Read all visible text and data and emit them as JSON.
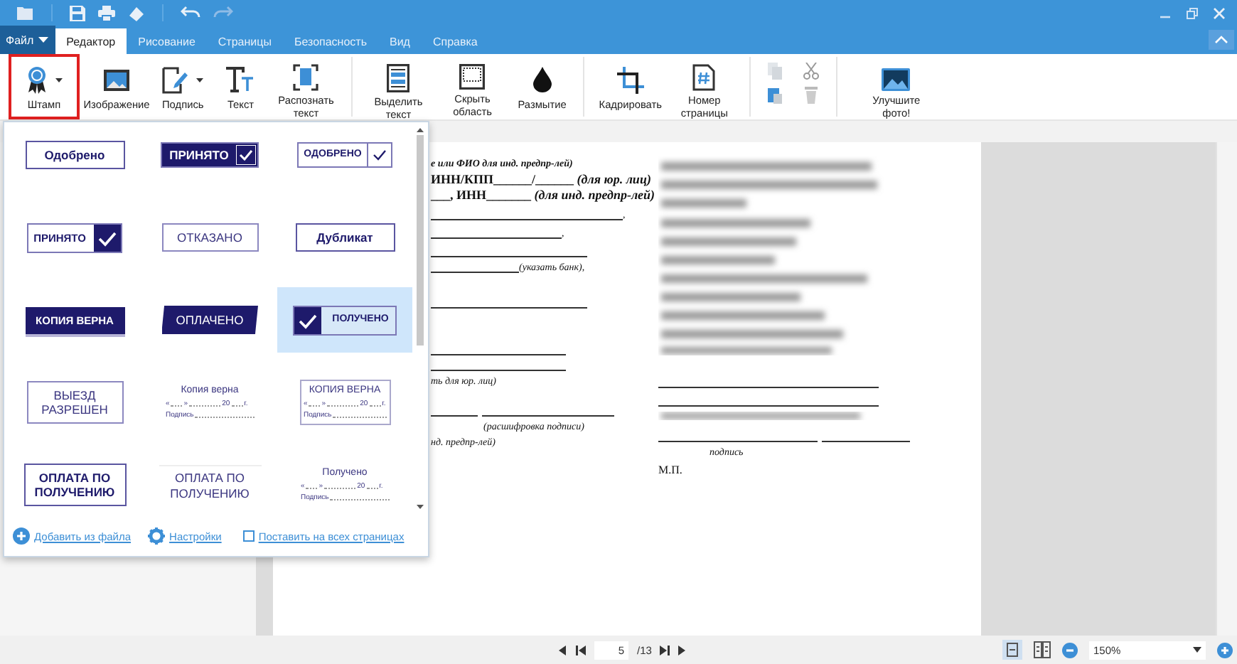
{
  "menu_tabs": [
    {
      "label": "Файл",
      "kind": "file",
      "selected": false
    },
    {
      "label": "Редактор",
      "kind": "tab",
      "selected": true
    },
    {
      "label": "Рисование",
      "kind": "tab",
      "selected": false
    },
    {
      "label": "Страницы",
      "kind": "tab",
      "selected": false
    },
    {
      "label": "Безопасность",
      "kind": "tab",
      "selected": false
    },
    {
      "label": "Вид",
      "kind": "tab",
      "selected": false
    },
    {
      "label": "Справка",
      "kind": "tab",
      "selected": false
    }
  ],
  "ribbon": [
    {
      "label": "Штамп",
      "dropdown": true,
      "highlighted": true
    },
    {
      "label": "Изображение",
      "dropdown": false,
      "highlighted": false
    },
    {
      "label": "Подпись",
      "dropdown": true,
      "highlighted": false
    },
    {
      "label": "Текст",
      "dropdown": false,
      "highlighted": false
    },
    {
      "label": "Распознать текст",
      "dropdown": false,
      "highlighted": false
    },
    {
      "label": "Выделить текст",
      "dropdown": false,
      "highlighted": false
    },
    {
      "label": "Скрыть область",
      "dropdown": false,
      "highlighted": false
    },
    {
      "label": "Размытие",
      "dropdown": false,
      "highlighted": false
    },
    {
      "label": "Кадрировать",
      "dropdown": false,
      "highlighted": false
    },
    {
      "label": "Номер страницы",
      "dropdown": false,
      "highlighted": false
    },
    {
      "label": "Улучшите фото!",
      "dropdown": false,
      "highlighted": false
    }
  ],
  "stamp_panel": {
    "stamps": [
      {
        "kind": "outline-bold",
        "text": "Одобрено",
        "selected": false
      },
      {
        "kind": "filled-check",
        "text": "ПРИНЯТО",
        "selected": false
      },
      {
        "kind": "outline-check",
        "text": "ОДОБРЕНО",
        "selected": false
      },
      {
        "kind": "check-box",
        "text": "ПРИНЯТО",
        "selected": false
      },
      {
        "kind": "outline-light",
        "text": "ОТКАЗАНО",
        "selected": false
      },
      {
        "kind": "outline-bold",
        "text": "Дубликат",
        "selected": false
      },
      {
        "kind": "filled",
        "text": "КОПИЯ ВЕРНА",
        "selected": false
      },
      {
        "kind": "slanted",
        "text": "ОПЛАЧЕНО",
        "selected": false
      },
      {
        "kind": "check-left",
        "text": "ПОЛУЧЕНО",
        "selected": true
      },
      {
        "kind": "outline-light",
        "text": "ВЫЕЗД РАЗРЕШЕН",
        "selected": false
      },
      {
        "kind": "form",
        "text": "Копия верна",
        "marks": [
          "«",
          "»",
          "20",
          "г."
        ],
        "sign": "Подпись",
        "selected": false
      },
      {
        "kind": "form-boxed",
        "text": "КОПИЯ ВЕРНА",
        "marks": [
          "«",
          "»",
          "20",
          "г."
        ],
        "sign": "Подпись",
        "selected": false
      },
      {
        "kind": "outline-bold",
        "text": "ОПЛАТА ПО ПОЛУЧЕНИЮ",
        "selected": false
      },
      {
        "kind": "plain",
        "text": "ОПЛАТА ПО ПОЛУЧЕНИЮ",
        "selected": false
      },
      {
        "kind": "form",
        "text": "Получено",
        "marks": [
          "«",
          "»",
          "20",
          "г."
        ],
        "sign": "Подпись",
        "selected": false
      }
    ],
    "actions": [
      {
        "label": "Добавить из файла"
      },
      {
        "label": "Настройки"
      }
    ],
    "all_pages": {
      "label": "Поставить на всех страницах",
      "checked": false
    }
  },
  "document": {
    "left_lines": [
      {
        "kind": "text",
        "text": "е или ФИО для инд. предпр-лей)"
      },
      {
        "kind": "text",
        "text": "ИНН/КПП______/______ *(для юр. лиц)*"
      },
      {
        "kind": "text",
        "text": "___, ИНН_______ *(для инд. предпр-лей)*"
      },
      {
        "kind": "rule",
        "suffix": ","
      },
      {
        "kind": "rule",
        "suffix": ","
      },
      {
        "kind": "rule"
      },
      {
        "kind": "rule",
        "suffix": "(указать банк),"
      },
      {
        "kind": "rule"
      },
      {
        "kind": "rule"
      },
      {
        "kind": "rule"
      },
      {
        "kind": "text",
        "text": "ть для юр. лиц)"
      },
      {
        "kind": "double-rule"
      },
      {
        "kind": "indent",
        "text": "(расшифровка подписи)"
      },
      {
        "kind": "text",
        "text": "нд. предпр-лей)"
      }
    ],
    "signature_label": "подпись",
    "seal_label": "М.П."
  },
  "status_bar": {
    "page": "5",
    "total": "/13",
    "zoom": "150%"
  }
}
